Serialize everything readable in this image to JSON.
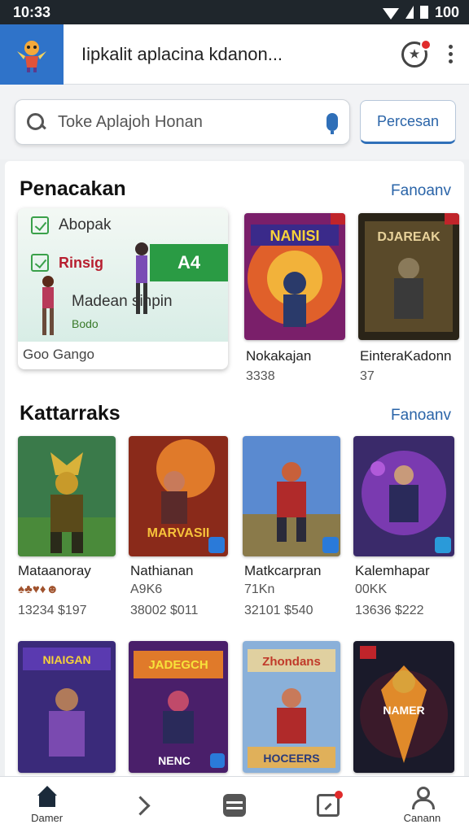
{
  "status_bar": {
    "time": "10:33",
    "battery": "100"
  },
  "header": {
    "title": "Iipkalit aplacina kdanon...",
    "logo_icon": "game-mascot-icon"
  },
  "search": {
    "placeholder": "Toke Aplajoh Honan",
    "filter_label": "Percesan"
  },
  "section1": {
    "title": "Penacakan",
    "link": "Fanoanv",
    "featured": {
      "row1": "Abopak",
      "row2": "Rinsig",
      "badge": "A4",
      "row3": "Madean sinpin",
      "row4": "Bodo",
      "caption": "Goo Gango"
    },
    "games": [
      {
        "name": "Nokakajan",
        "meta": "3338",
        "art": "NANISI"
      },
      {
        "name": "EinteraKadonn",
        "meta": "37",
        "art": "DJAREAK"
      }
    ]
  },
  "section2": {
    "title": "Kattarraks",
    "link": "Fanoanv",
    "games": [
      {
        "name": "Mataanoray",
        "sub": "",
        "stats": "13234   $197",
        "art": ""
      },
      {
        "name": "Nathianan",
        "sub": "A9K6",
        "stats": "38002   $011",
        "art": "MARVASII"
      },
      {
        "name": "Matkcarpran",
        "sub": "71Kn",
        "stats": "32101   $540",
        "art": ""
      },
      {
        "name": "Kalemhapar",
        "sub": "00KK",
        "stats": "13636   $222",
        "art": ""
      }
    ]
  },
  "section3": {
    "games": [
      {
        "art_top": "NIAIGAN",
        "art_bottom": ""
      },
      {
        "art_top": "JADEGCH",
        "art_bottom": "NENC"
      },
      {
        "art_top": "Zhondans",
        "art_bottom": "HOCEERS"
      },
      {
        "art_top": "NAMER",
        "art_bottom": ""
      }
    ]
  },
  "bottom_nav": [
    {
      "label": "Damer",
      "icon": "home-icon"
    },
    {
      "label": "",
      "icon": "chevron-right-icon"
    },
    {
      "label": "",
      "icon": "list-icon"
    },
    {
      "label": "",
      "icon": "tablet-icon"
    },
    {
      "label": "Canann",
      "icon": "person-icon"
    }
  ],
  "colors": {
    "accent": "#2a64a8",
    "logo_bg": "#2f73c9",
    "status_bar": "#1f262c",
    "featured_green": "#2a9b44"
  }
}
